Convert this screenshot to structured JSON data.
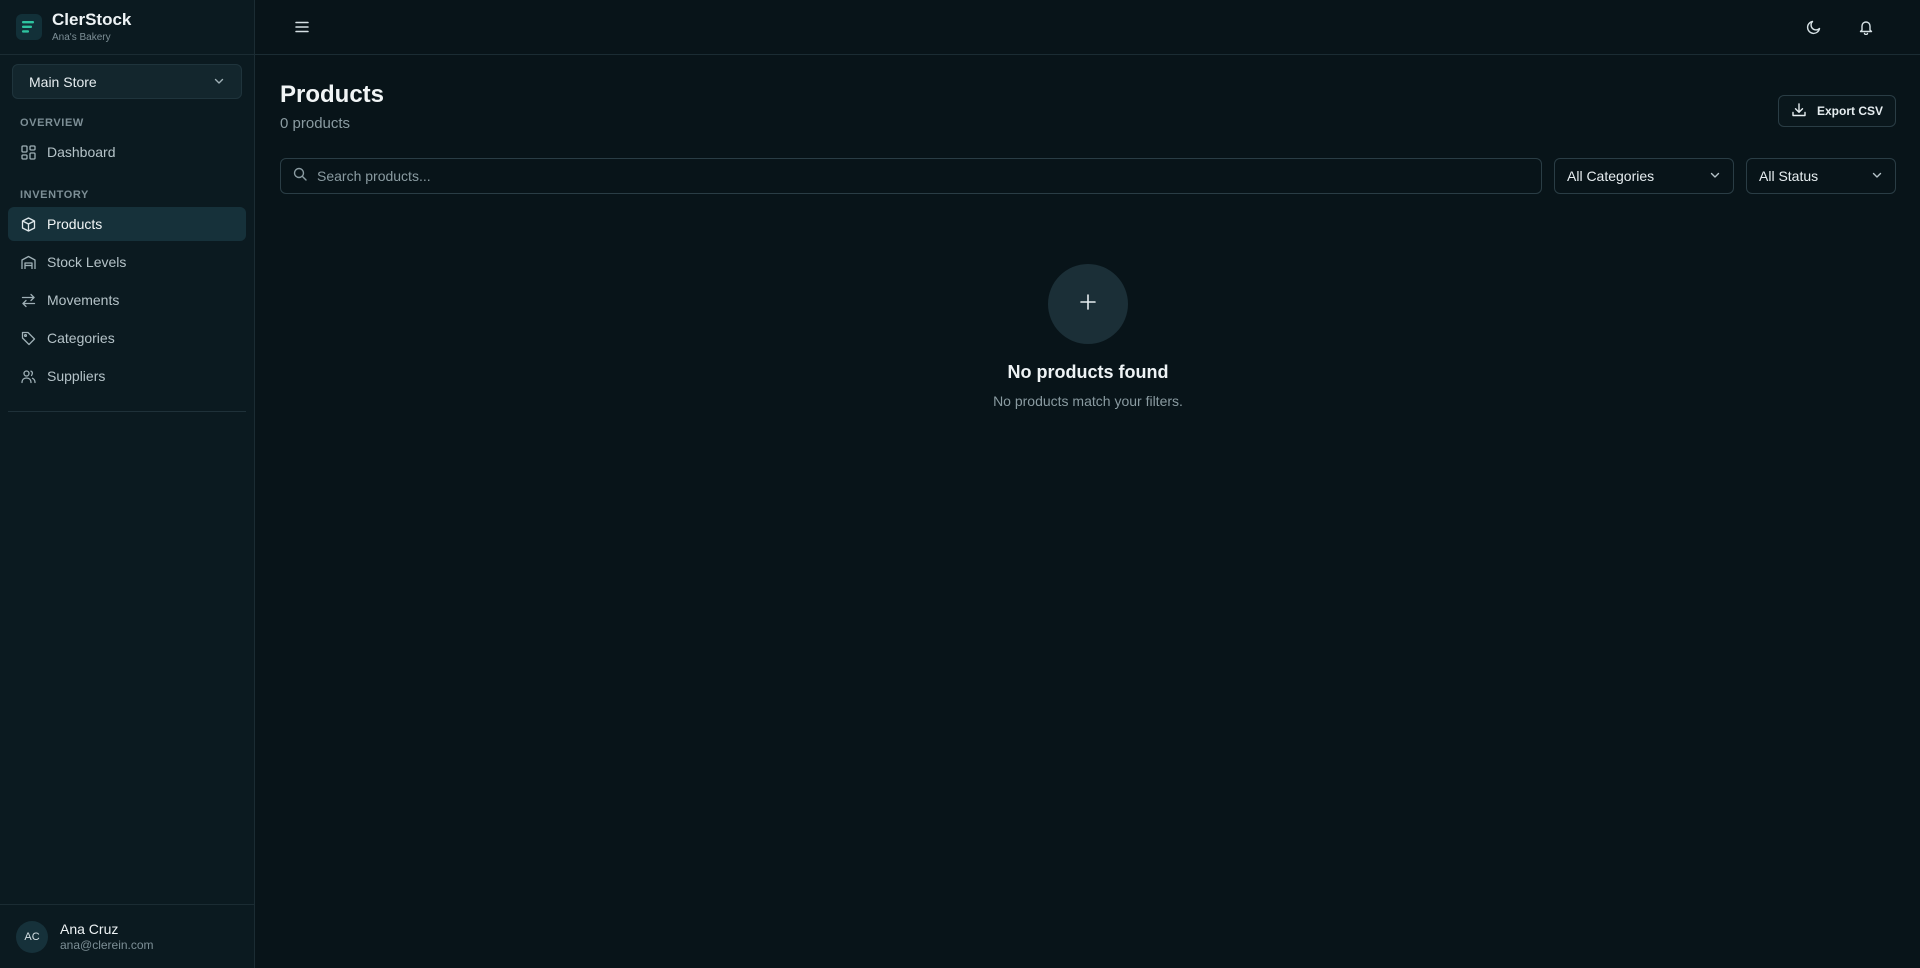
{
  "brand": {
    "name": "ClerStock",
    "subtitle": "Ana's Bakery"
  },
  "store_selector": {
    "value": "Main Store"
  },
  "sidebar": {
    "sections": [
      {
        "label": "OVERVIEW",
        "items": [
          {
            "label": "Dashboard",
            "icon": "grid-icon"
          }
        ]
      },
      {
        "label": "INVENTORY",
        "items": [
          {
            "label": "Products",
            "icon": "box-icon",
            "active": true
          },
          {
            "label": "Stock Levels",
            "icon": "warehouse-icon"
          },
          {
            "label": "Movements",
            "icon": "arrows-left-right-icon"
          },
          {
            "label": "Categories",
            "icon": "tag-icon"
          },
          {
            "label": "Suppliers",
            "icon": "users-icon"
          }
        ]
      }
    ]
  },
  "user": {
    "initials": "AC",
    "name": "Ana Cruz",
    "email": "ana@clerein.com"
  },
  "page": {
    "title": "Products",
    "subtitle": "0 products",
    "export_label": "Export CSV"
  },
  "filters": {
    "search_placeholder": "Search products...",
    "category": "All Categories",
    "status": "All Status"
  },
  "empty_state": {
    "title": "No products found",
    "message": "No products match your filters."
  },
  "colors": {
    "background": "#081419",
    "sidebar": "#0b1a20",
    "accent": "#2ec4a0",
    "active_item": "#16313a"
  }
}
